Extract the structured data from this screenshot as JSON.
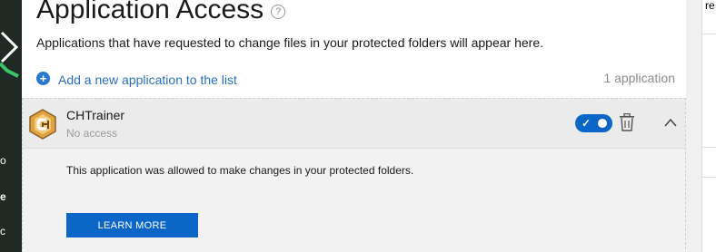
{
  "header": {
    "title": "Application Access",
    "help_icon": "question-circle-icon"
  },
  "description": "Applications that have requested to change files in your protected folders will appear here.",
  "add_app": {
    "icon": "plus-circle-icon",
    "label": "Add a new application to the list"
  },
  "app_count": "1 application",
  "apps": [
    {
      "name": "CHTrainer",
      "status": "No access",
      "icon": "chtrainer-app-icon",
      "toggle_on": true,
      "detail": "This application was allowed to make changes in your protected folders.",
      "learn_more_label": "LEARN MORE"
    }
  ],
  "background_windows": {
    "left_fragments": [
      "o",
      "e",
      "c"
    ],
    "right_fragment": "re"
  },
  "colors": {
    "accent": "#0c66c8",
    "link": "#2b6fc4",
    "panel": "#f2f2f2",
    "panel_header": "#ebebeb",
    "muted_text": "#9a9a9a"
  }
}
